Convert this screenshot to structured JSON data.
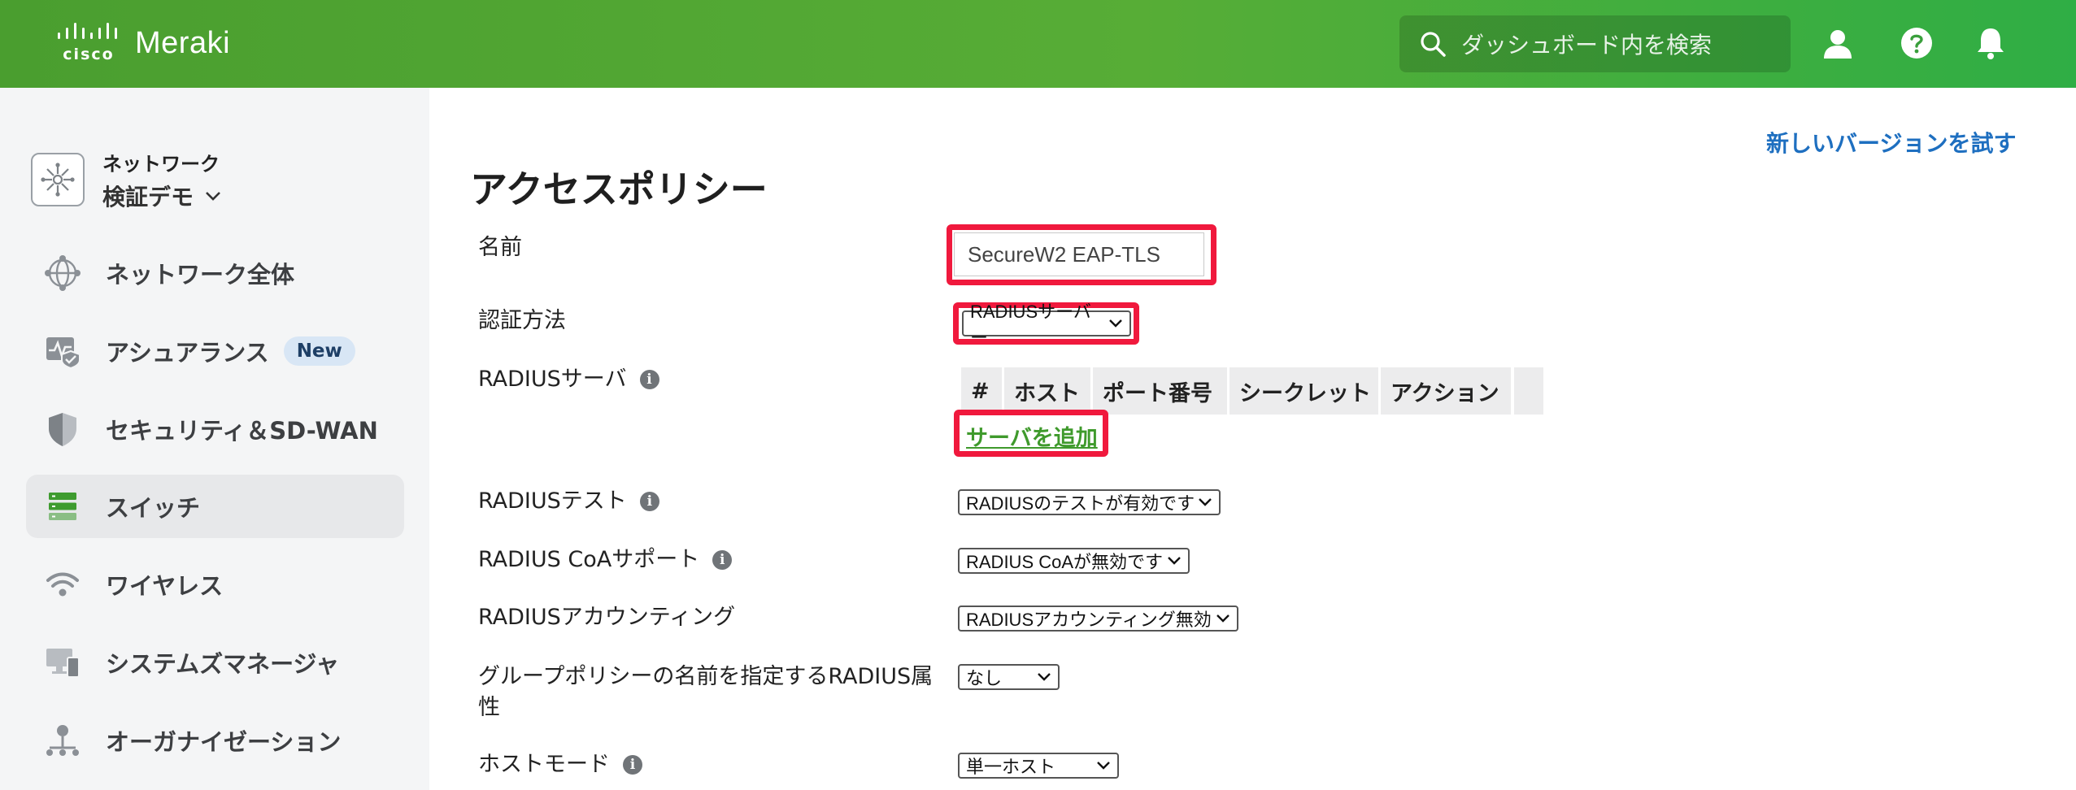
{
  "header": {
    "brand_top": "cisco",
    "brand_name": "Meraki",
    "search_placeholder": "ダッシュボード内を検索",
    "icons": [
      "user-icon",
      "help-icon",
      "bell-icon"
    ]
  },
  "sidebar": {
    "network_caption": "ネットワーク",
    "network_name": "検証デモ",
    "items": [
      {
        "label": "ネットワーク全体",
        "icon": "network-globe-icon"
      },
      {
        "label": "アシュアランス",
        "icon": "assurance-icon",
        "badge": "New"
      },
      {
        "label": "セキュリティ＆SD-WAN",
        "icon": "shield-icon"
      },
      {
        "label": "スイッチ",
        "icon": "switch-icon",
        "active": true
      },
      {
        "label": "ワイヤレス",
        "icon": "wifi-icon"
      },
      {
        "label": "システムズマネージャ",
        "icon": "devices-icon"
      },
      {
        "label": "オーガナイゼーション",
        "icon": "organization-icon"
      }
    ]
  },
  "main": {
    "try_new_version": "新しいバージョンを試す",
    "title": "アクセスポリシー",
    "labels": {
      "name": "名前",
      "auth_method": "認証方法",
      "radius_server": "RADIUSサーバ",
      "radius_test": "RADIUSテスト",
      "radius_coa": "RADIUS CoAサポート",
      "radius_accounting": "RADIUSアカウンティング",
      "group_policy_attr": "グループポリシーの名前を指定するRADIUS属性",
      "host_mode": "ホストモード"
    },
    "name_value": "SecureW2 EAP-TLS",
    "auth_method_value": "RADIUSサーバー",
    "server_table": {
      "columns": [
        "#",
        "ホスト",
        "ポート番号",
        "シークレット",
        "アクション"
      ]
    },
    "add_server": "サーバを追加",
    "radius_test_value": "RADIUSのテストが有効です",
    "radius_coa_value": "RADIUS CoAが無効です",
    "radius_accounting_value": "RADIUSアカウンティング無効",
    "group_policy_attr_value": "なし",
    "host_mode_value": "単一ホスト",
    "colors": {
      "highlight": "#f0193d",
      "accent_green": "#4a9e2f",
      "link_blue": "#1e6fc0"
    }
  }
}
